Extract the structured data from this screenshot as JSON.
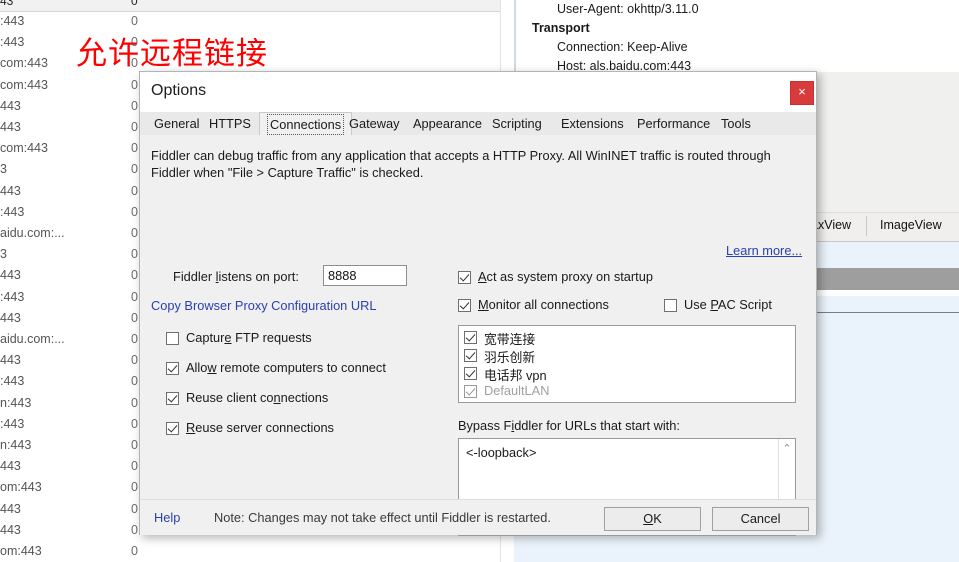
{
  "background": {
    "session_list": {
      "header": {
        "host_col": "43",
        "num_col": "0"
      },
      "rows": [
        {
          "host": ":443",
          "num": "0"
        },
        {
          "host": ":443",
          "num": "0"
        },
        {
          "host": "com:443",
          "num": "0"
        },
        {
          "host": "com:443",
          "num": "0"
        },
        {
          "host": "443",
          "num": "0"
        },
        {
          "host": "443",
          "num": "0"
        },
        {
          "host": "com:443",
          "num": "0"
        },
        {
          "host": "3",
          "num": "0"
        },
        {
          "host": "443",
          "num": "0"
        },
        {
          "host": ":443",
          "num": "0"
        },
        {
          "host": "aidu.com:...",
          "num": "0"
        },
        {
          "host": "3",
          "num": "0"
        },
        {
          "host": "443",
          "num": "0"
        },
        {
          "host": ":443",
          "num": "0"
        },
        {
          "host": "443",
          "num": "0"
        },
        {
          "host": "aidu.com:...",
          "num": "0"
        },
        {
          "host": "443",
          "num": "0"
        },
        {
          "host": ":443",
          "num": "0"
        },
        {
          "host": "n:443",
          "num": "0"
        },
        {
          "host": ":443",
          "num": "0"
        },
        {
          "host": "n:443",
          "num": "0"
        },
        {
          "host": "443",
          "num": "0"
        },
        {
          "host": "om:443",
          "num": "0"
        },
        {
          "host": "443",
          "num": "0"
        },
        {
          "host": "443",
          "num": "0"
        },
        {
          "host": "om:443",
          "num": "0"
        }
      ]
    },
    "inspector": {
      "lines": [
        {
          "text": "User-Agent: okhttp/3.11.0",
          "bold": false
        },
        {
          "text": "Transport",
          "bold": true
        },
        {
          "text": "Connection: Keep-Alive",
          "bold": false
        },
        {
          "text": "Host: als.baidu.com:443",
          "bold": false
        }
      ],
      "tabs": [
        "axView",
        "ImageView"
      ]
    }
  },
  "annotation": {
    "text": "允许远程链接",
    "color": "#fe0000"
  },
  "dialog": {
    "title": "Options",
    "close_label": "×",
    "tabs": [
      {
        "label": "General",
        "selected": false
      },
      {
        "label": "HTTPS",
        "selected": false
      },
      {
        "label": "Connections",
        "selected": true
      },
      {
        "label": "Gateway",
        "selected": false
      },
      {
        "label": "Appearance",
        "selected": false
      },
      {
        "label": "Scripting",
        "selected": false
      },
      {
        "label": "Extensions",
        "selected": false
      },
      {
        "label": "Performance",
        "selected": false
      },
      {
        "label": "Tools",
        "selected": false
      }
    ],
    "description": "Fiddler can debug traffic from any application that accepts a HTTP Proxy. All WinINET traffic is routed through Fiddler when \"File > Capture Traffic\" is checked.",
    "learn_more": "Learn more...",
    "port": {
      "label_pre": "Fiddler ",
      "label_accel": "l",
      "label_post": "istens on port:",
      "value": "8888"
    },
    "copy_proxy_link": "Copy Browser Proxy Configuration URL",
    "left_checkboxes": [
      {
        "pre": "Captur",
        "accel": "e",
        "post": " FTP requests",
        "checked": false
      },
      {
        "pre": "Allo",
        "accel": "w",
        "post": " remote computers to connect",
        "checked": true
      },
      {
        "pre": "Reuse client co",
        "accel": "n",
        "post": "nections",
        "checked": true
      },
      {
        "pre": "",
        "accel": "R",
        "post": "euse server connections",
        "checked": true
      }
    ],
    "right_checkboxes": [
      {
        "pre": "",
        "accel": "A",
        "post": "ct as system proxy on startup",
        "checked": true
      },
      {
        "pre": "",
        "accel": "M",
        "post": "onitor all connections",
        "checked": true
      },
      {
        "pre": "Use ",
        "accel": "P",
        "post": "AC Script",
        "checked": false
      }
    ],
    "network_list": [
      {
        "label": "宽带连接",
        "checked": true,
        "dim": false
      },
      {
        "label": "羽乐创新",
        "checked": true,
        "dim": false
      },
      {
        "label": "电话邦 vpn",
        "checked": true,
        "dim": false
      },
      {
        "label": "DefaultLAN",
        "checked": true,
        "dim": true
      }
    ],
    "bypass": {
      "label_pre": "Bypass F",
      "label_accel": "i",
      "label_post": "ddler for URLs that start with:",
      "value": "<-loopback>",
      "scroll_up": "⌃",
      "scroll_down": "⌄"
    },
    "footer": {
      "help": "Help",
      "note": "Note: Changes may not take effect until Fiddler is restarted.",
      "ok_pre": "",
      "ok_accel": "O",
      "ok_post": "K",
      "cancel": "Cancel"
    }
  }
}
